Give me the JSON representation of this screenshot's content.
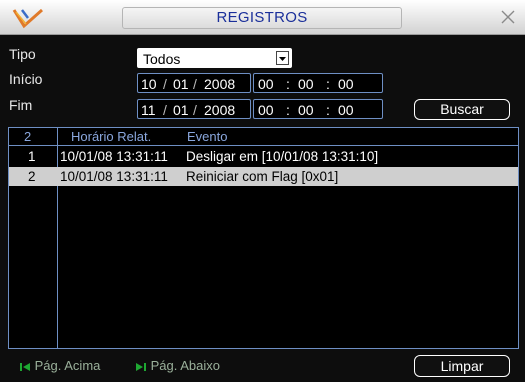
{
  "window": {
    "title": "REGISTROS",
    "accent_title_color": "#1a2f9a",
    "icons": {
      "logo": "brand-logo-icon",
      "close": "close-icon"
    }
  },
  "form": {
    "tipo": {
      "label": "Tipo",
      "value": "Todos"
    },
    "inicio": {
      "label": "Início",
      "day": "10",
      "month": "01",
      "year": "2008",
      "hh": "00",
      "mm": "00",
      "ss": "00"
    },
    "fim": {
      "label": "Fim",
      "day": "11",
      "month": "01",
      "year": "2008",
      "hh": "00",
      "mm": "00",
      "ss": "00"
    },
    "search_label": "Buscar"
  },
  "table": {
    "headers": [
      "2",
      "Horário Relat.",
      "Evento"
    ],
    "rows": [
      {
        "idx": "1",
        "time": "10/01/08 13:31:11",
        "event": "Desligar em [10/01/08 13:31:10]",
        "selected": false
      },
      {
        "idx": "2",
        "time": "10/01/08 13:31:11",
        "event": "Reiniciar com Flag [0x01]",
        "selected": true
      }
    ]
  },
  "footer": {
    "prev_label": "Pág. Acima",
    "next_label": "Pág. Abaixo",
    "clear_label": "Limpar"
  }
}
